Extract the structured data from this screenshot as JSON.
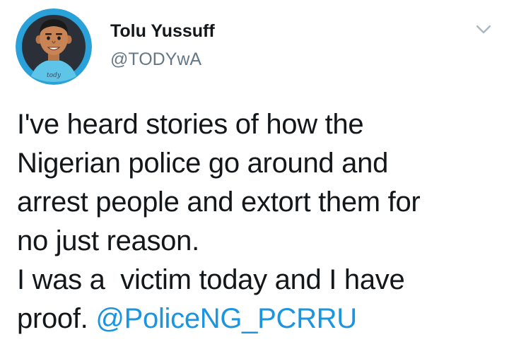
{
  "author": {
    "display_name": "Tolu Yussuff",
    "handle": "@TODYwA",
    "avatar_signature": "tody"
  },
  "icons": {
    "more_menu": "chevron-down-icon"
  },
  "tweet": {
    "lines": [
      "I've heard stories of how the",
      "Nigerian police go around and",
      "arrest people and extort them for",
      "no just reason.",
      "I was a  victim today and I have"
    ],
    "last_line_prefix": "proof. ",
    "mention": "@PoliceNG_PCRRU"
  },
  "colors": {
    "text": "#14171a",
    "secondary": "#657786",
    "link": "#1b95e0",
    "avatar_bg": "#2aa1d8"
  }
}
